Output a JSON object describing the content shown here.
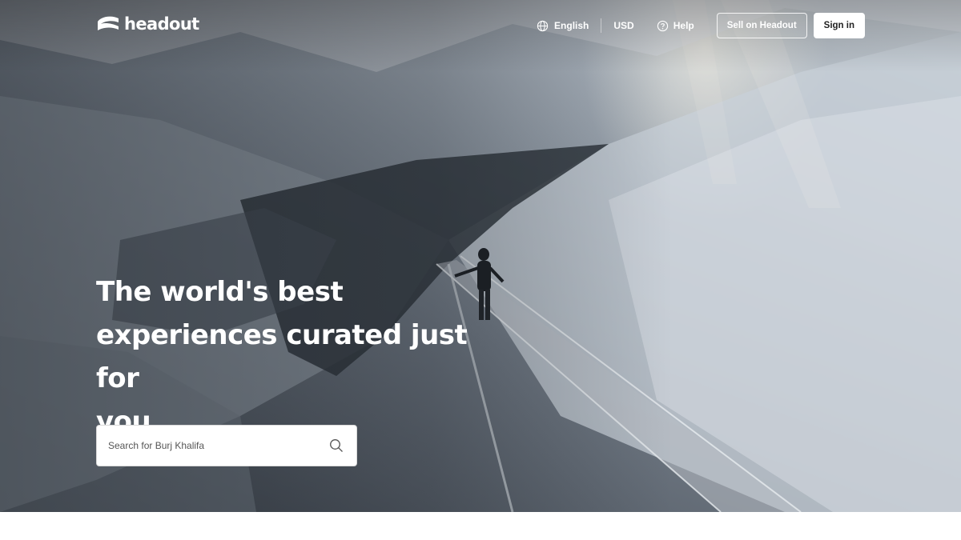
{
  "brand": {
    "name": "headout"
  },
  "nav": {
    "language": "English",
    "currency": "USD",
    "help": "Help",
    "sell": "Sell on Headout",
    "signin": "Sign in"
  },
  "hero": {
    "headline_line1": "The world's best",
    "headline_line2": "experiences curated just for",
    "headline_line3": "you"
  },
  "search": {
    "placeholder": "Search for Burj Khalifa"
  },
  "colors": {
    "text_on_hero": "#ffffff",
    "page_background": "#ffffff",
    "button_bg": "#ffffff"
  },
  "icons": [
    "headout-logo-icon",
    "globe-icon",
    "help-circle-icon",
    "search-icon"
  ]
}
